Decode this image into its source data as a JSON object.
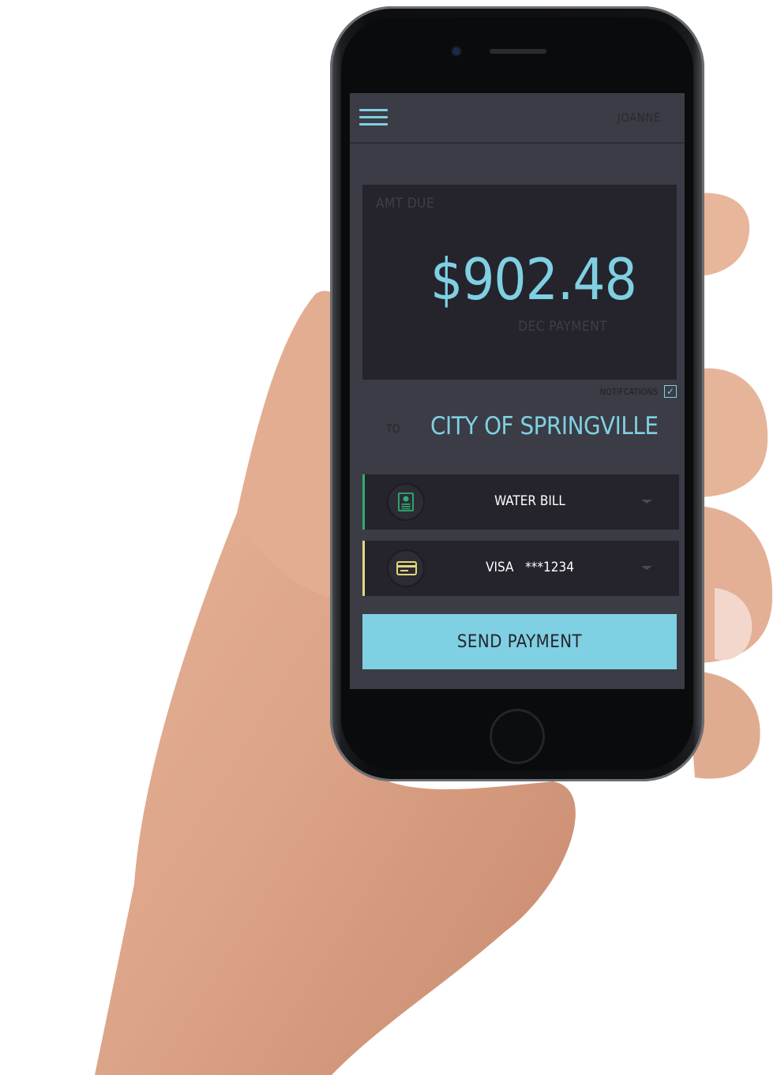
{
  "header": {
    "username": "JOANNE"
  },
  "amount": {
    "label": "AMT DUE",
    "value": "$902.48",
    "period": "DEC  PAYMENT"
  },
  "notifications": {
    "label": "NOTIFCATIONS",
    "checked": true,
    "check_glyph": "✓"
  },
  "payee": {
    "to_label": "TO",
    "name": "CITY OF SPRINGVILLE"
  },
  "bill": {
    "label": "WATER BILL",
    "icon": "bill-document-icon",
    "accent": "#2fae72"
  },
  "payment_method": {
    "label": "VISA   ***1234",
    "icon": "credit-card-icon",
    "accent": "#e3d77c"
  },
  "send_button": {
    "label": "SEND PAYMENT"
  },
  "colors": {
    "accent": "#7fd0e3",
    "background": "#3b3c45",
    "card": "#25242d"
  }
}
